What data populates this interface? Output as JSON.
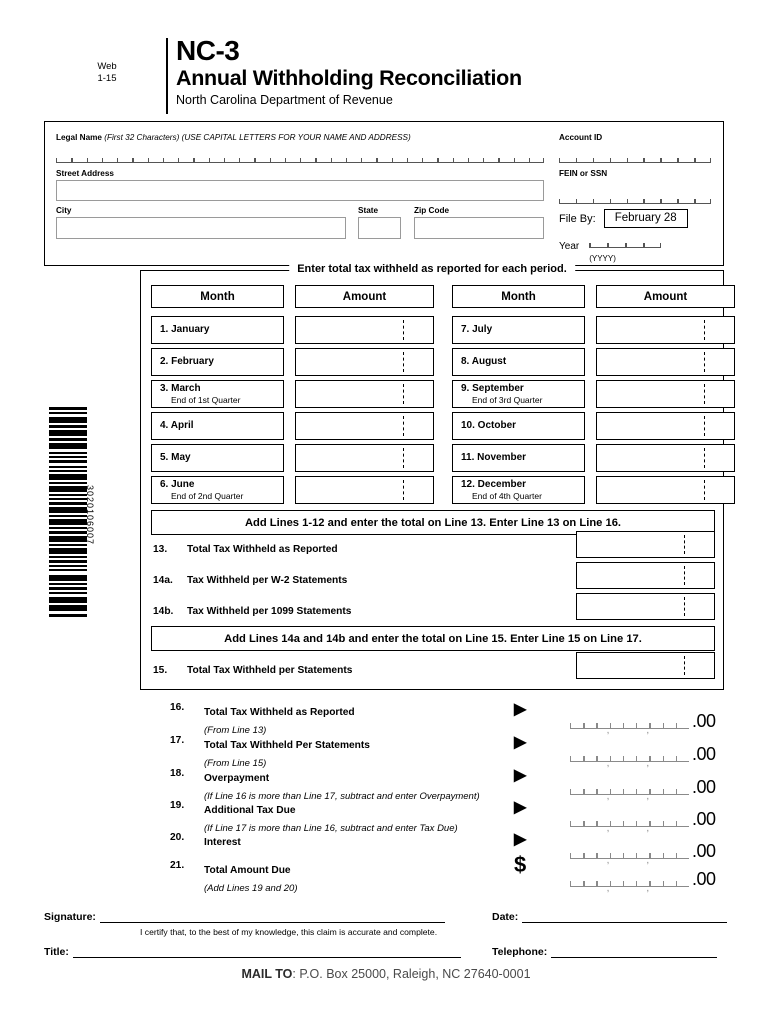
{
  "header": {
    "web": "Web",
    "revision": "1-15",
    "form_number": "NC-3",
    "form_title": "Annual Withholding Reconciliation",
    "agency": "North Carolina Department of Revenue"
  },
  "taxpayer": {
    "legal_name_label": "Legal Name",
    "legal_name_hint": "(First 32 Characters) (USE CAPITAL LETTERS FOR YOUR NAME AND ADDRESS)",
    "street_label": "Street Address",
    "city_label": "City",
    "state_label": "State",
    "zip_label": "Zip Code",
    "account_id_label": "Account ID",
    "fein_label": "FEIN or SSN",
    "file_by_label": "File By:",
    "file_by_value": "February 28",
    "year_label": "Year",
    "year_hint": "(YYYY)"
  },
  "barcode": {
    "digits": "3020106007"
  },
  "months_section": {
    "legend": "Enter total tax withheld as reported for each period.",
    "headers": {
      "month": "Month",
      "amount": "Amount"
    },
    "left_rows": [
      {
        "name": "1. January",
        "sub": ""
      },
      {
        "name": "2. February",
        "sub": ""
      },
      {
        "name": "3. March",
        "sub": "End of 1st Quarter"
      },
      {
        "name": "4. April",
        "sub": ""
      },
      {
        "name": "5. May",
        "sub": ""
      },
      {
        "name": "6. June",
        "sub": "End of 2nd Quarter"
      }
    ],
    "right_rows": [
      {
        "name": "7. July",
        "sub": ""
      },
      {
        "name": "8. August",
        "sub": ""
      },
      {
        "name": "9. September",
        "sub": "End of 3rd Quarter"
      },
      {
        "name": "10. October",
        "sub": ""
      },
      {
        "name": "11. November",
        "sub": ""
      },
      {
        "name": "12. December",
        "sub": "End of 4th Quarter"
      }
    ],
    "banner_1": "Add Lines 1-12 and enter the total on Line 13.  Enter Line 13 on Line 16.",
    "banner_2": "Add Lines 14a and 14b and enter the total on Line 15.  Enter Line 15 on Line 17.",
    "lines": [
      {
        "no": "13.",
        "label": "Total Tax Withheld as Reported"
      },
      {
        "no": "14a.",
        "label": "Tax Withheld per W-2 Statements"
      },
      {
        "no": "14b.",
        "label": "Tax Withheld per 1099 Statements"
      },
      {
        "no": "15.",
        "label": "Total Tax Withheld per Statements"
      }
    ]
  },
  "summary_lines": [
    {
      "no": "16.",
      "title": "Total Tax Withheld as Reported",
      "note": "(From Line 13)",
      "marker": "▶",
      "cents": ".00"
    },
    {
      "no": "17.",
      "title": "Total Tax Withheld Per Statements",
      "note": "(From Line 15)",
      "marker": "▶",
      "cents": ".00"
    },
    {
      "no": "18.",
      "title": "Overpayment",
      "note": "(If Line 16 is more than Line 17, subtract and enter Overpayment)",
      "marker": "▶",
      "cents": ".00"
    },
    {
      "no": "19.",
      "title": "Additional Tax Due",
      "note": "(If Line 17 is more than Line 16, subtract and enter Tax Due)",
      "marker": "▶",
      "cents": ".00"
    },
    {
      "no": "20.",
      "title": "Interest",
      "note": "",
      "marker": "▶",
      "cents": ".00"
    },
    {
      "no": "21.",
      "title": "Total Amount Due",
      "note": "(Add Lines 19 and 20)",
      "marker": "$",
      "cents": ".00"
    }
  ],
  "footer": {
    "signature_label": "Signature:",
    "date_label": "Date:",
    "certify": "I certify that, to the best of my knowledge, this claim is accurate and complete.",
    "title_label": "Title:",
    "telephone_label": "Telephone:",
    "mail_to_bold": "MAIL TO",
    "mail_to_rest": ": P.O. Box 25000, Raleigh, NC 27640-0001"
  }
}
